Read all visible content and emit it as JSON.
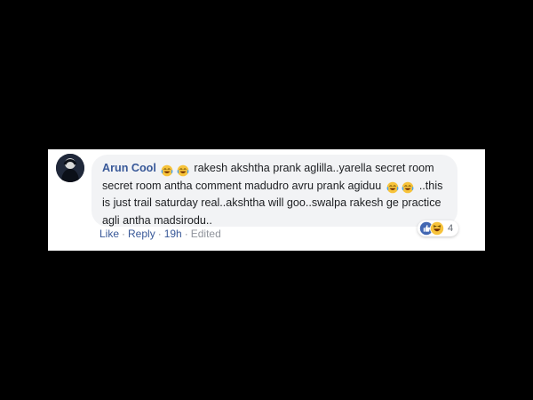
{
  "comment": {
    "author": "Arun Cool",
    "avatar_icon": "profile-photo",
    "text_lines": [
      "rakesh akshtha prank aglilla..yarella secret room",
      "secret room antha comment madudro avru prank agiduu",
      "..this",
      "is just trail saturday real..akshtha will goo..swalpa rakesh ge practice",
      "agli antha madsirodu.."
    ],
    "emoji_name": "face-with-tears-of-joy"
  },
  "actions": {
    "like": "Like",
    "reply": "Reply",
    "time": "19h",
    "edited": "Edited"
  },
  "reactions": {
    "icons": [
      "like-icon",
      "haha-icon"
    ],
    "count": "4"
  },
  "colors": {
    "accent": "#385898",
    "bubble": "#f2f3f5",
    "text": "#1c1e21",
    "muted": "#90949c"
  }
}
